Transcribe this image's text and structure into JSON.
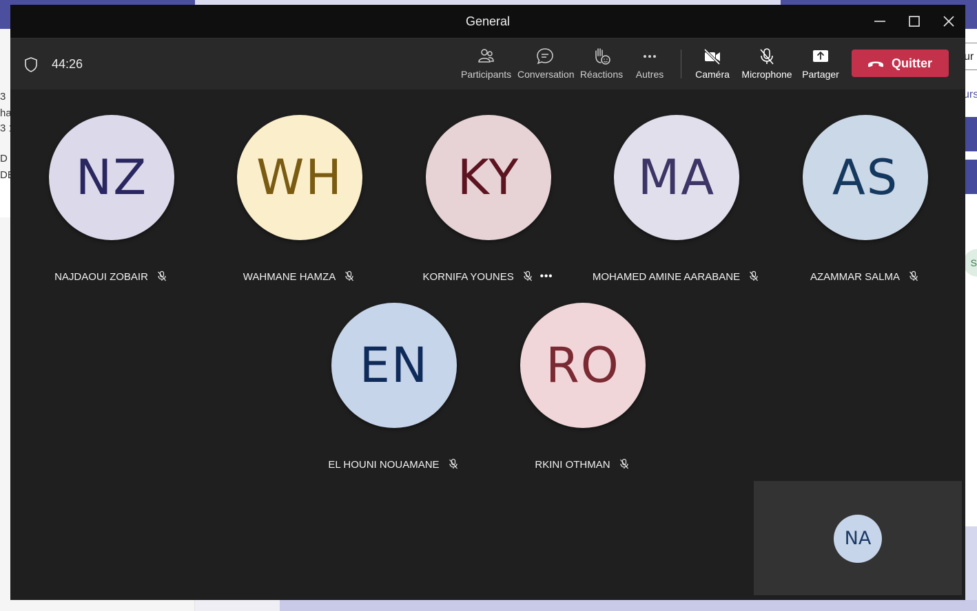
{
  "background": {
    "left_text_lines": [
      "3",
      "ha",
      "3 1",
      "D ,",
      "DE"
    ],
    "right_top_text": "ur",
    "right_chip_text": "urs",
    "right_avatar_text": "S"
  },
  "window": {
    "title": "General"
  },
  "toolbar": {
    "timer": "44:26",
    "buttons": {
      "participants": "Participants",
      "conversation": "Conversation",
      "reactions": "Réactions",
      "more": "Autres",
      "camera": "Caméra",
      "microphone": "Microphone",
      "share": "Partager"
    },
    "leave_label": "Quitter"
  },
  "colors": {
    "leave": "#c4314b",
    "window_bg": "#1f1f1f",
    "toolbar_bg": "#292929",
    "titlebar_bg": "#0f0f0f"
  },
  "participants": [
    {
      "initials": "NZ",
      "name": "NAJDAOUI ZOBAIR",
      "muted": true,
      "bg": "#dcd9eb",
      "fg": "#2a2660"
    },
    {
      "initials": "WH",
      "name": "WAHMANE HAMZA",
      "muted": true,
      "bg": "#fbeecb",
      "fg": "#7a5b12"
    },
    {
      "initials": "KY",
      "name": "KORNIFA YOUNES",
      "muted": true,
      "bg": "#e7d2d5",
      "fg": "#5c1420"
    },
    {
      "initials": "MA",
      "name": "MOHAMED AMINE AARABANE",
      "muted": true,
      "bg": "#e2dfec",
      "fg": "#3c3566"
    },
    {
      "initials": "AS",
      "name": "AZAMMAR SALMA",
      "muted": true,
      "bg": "#cbd8e7",
      "fg": "#15385e"
    },
    {
      "initials": "EN",
      "name": "EL HOUNI NOUAMANE",
      "muted": true,
      "bg": "#c7d5ea",
      "fg": "#0f2b5a"
    },
    {
      "initials": "RO",
      "name": "RKINI OTHMAN",
      "muted": true,
      "bg": "#f1d6d9",
      "fg": "#7a2a32"
    }
  ],
  "participant_more_option": "•••",
  "self_view": {
    "initials": "NA"
  }
}
